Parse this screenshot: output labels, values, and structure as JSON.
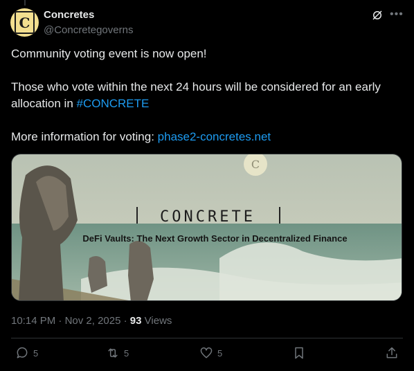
{
  "author": {
    "display_name": "Concretes",
    "handle": "@Concretegoverns",
    "avatar_letter": "C"
  },
  "tweet": {
    "line1": "Community voting event is now open!",
    "line2_text": "Those who vote within the next 24 hours will be considered for an early allocation in ",
    "hashtag": "#CONCRETE",
    "line3_text": "More information for voting:  ",
    "link": "phase2-concretes.net"
  },
  "media": {
    "brand": "CONCRETE",
    "headline": "DeFi Vaults: The Next Growth Sector in Decentralized Finance",
    "moon_letter": "C"
  },
  "meta": {
    "time": "10:14 PM",
    "separator": "·",
    "date": "Nov 2, 2025",
    "views_count": "93",
    "views_label": "Views"
  },
  "actions": {
    "reply_count": "5",
    "retweet_count": "5",
    "like_count": "5"
  },
  "colors": {
    "background": "#000000",
    "text": "#e7e9ea",
    "muted": "#71767b",
    "accent": "#1d9bf0"
  }
}
